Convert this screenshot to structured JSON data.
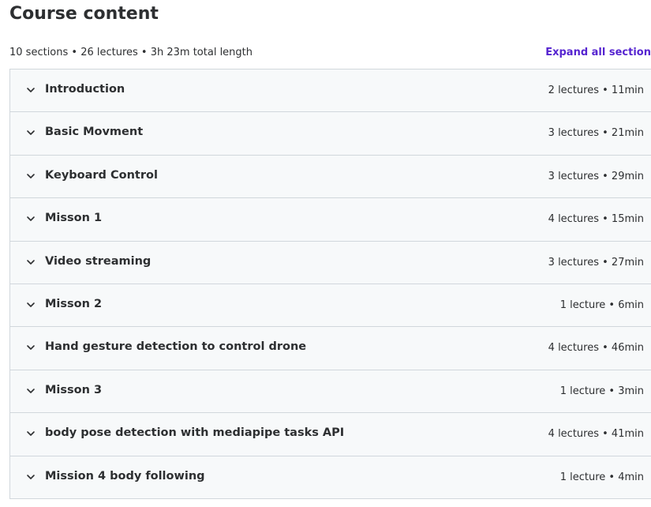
{
  "header": {
    "title": "Course content",
    "summary": "10 sections • 26 lectures • 3h 23m total length",
    "expand_all_label": "Expand all section"
  },
  "accent_color": "#5624d0",
  "sections": [
    {
      "title": "Introduction",
      "info": "2 lectures • 11min",
      "icon": "chevron-down-icon"
    },
    {
      "title": "Basic Movment",
      "info": "3 lectures • 21min",
      "icon": "chevron-down-icon"
    },
    {
      "title": "Keyboard Control",
      "info": "3 lectures • 29min",
      "icon": "chevron-down-icon"
    },
    {
      "title": "Misson 1",
      "info": "4 lectures • 15min",
      "icon": "chevron-down-icon"
    },
    {
      "title": "Video streaming",
      "info": "3 lectures • 27min",
      "icon": "chevron-down-icon"
    },
    {
      "title": "Misson 2",
      "info": "1 lecture • 6min",
      "icon": "chevron-down-icon"
    },
    {
      "title": "Hand gesture detection to control drone",
      "info": "4 lectures • 46min",
      "icon": "chevron-down-icon"
    },
    {
      "title": "Misson 3",
      "info": "1 lecture • 3min",
      "icon": "chevron-down-icon"
    },
    {
      "title": "body pose detection with mediapipe tasks API",
      "info": "4 lectures • 41min",
      "icon": "chevron-down-icon"
    },
    {
      "title": "Mission 4 body following",
      "info": "1 lecture • 4min",
      "icon": "chevron-down-icon"
    }
  ]
}
